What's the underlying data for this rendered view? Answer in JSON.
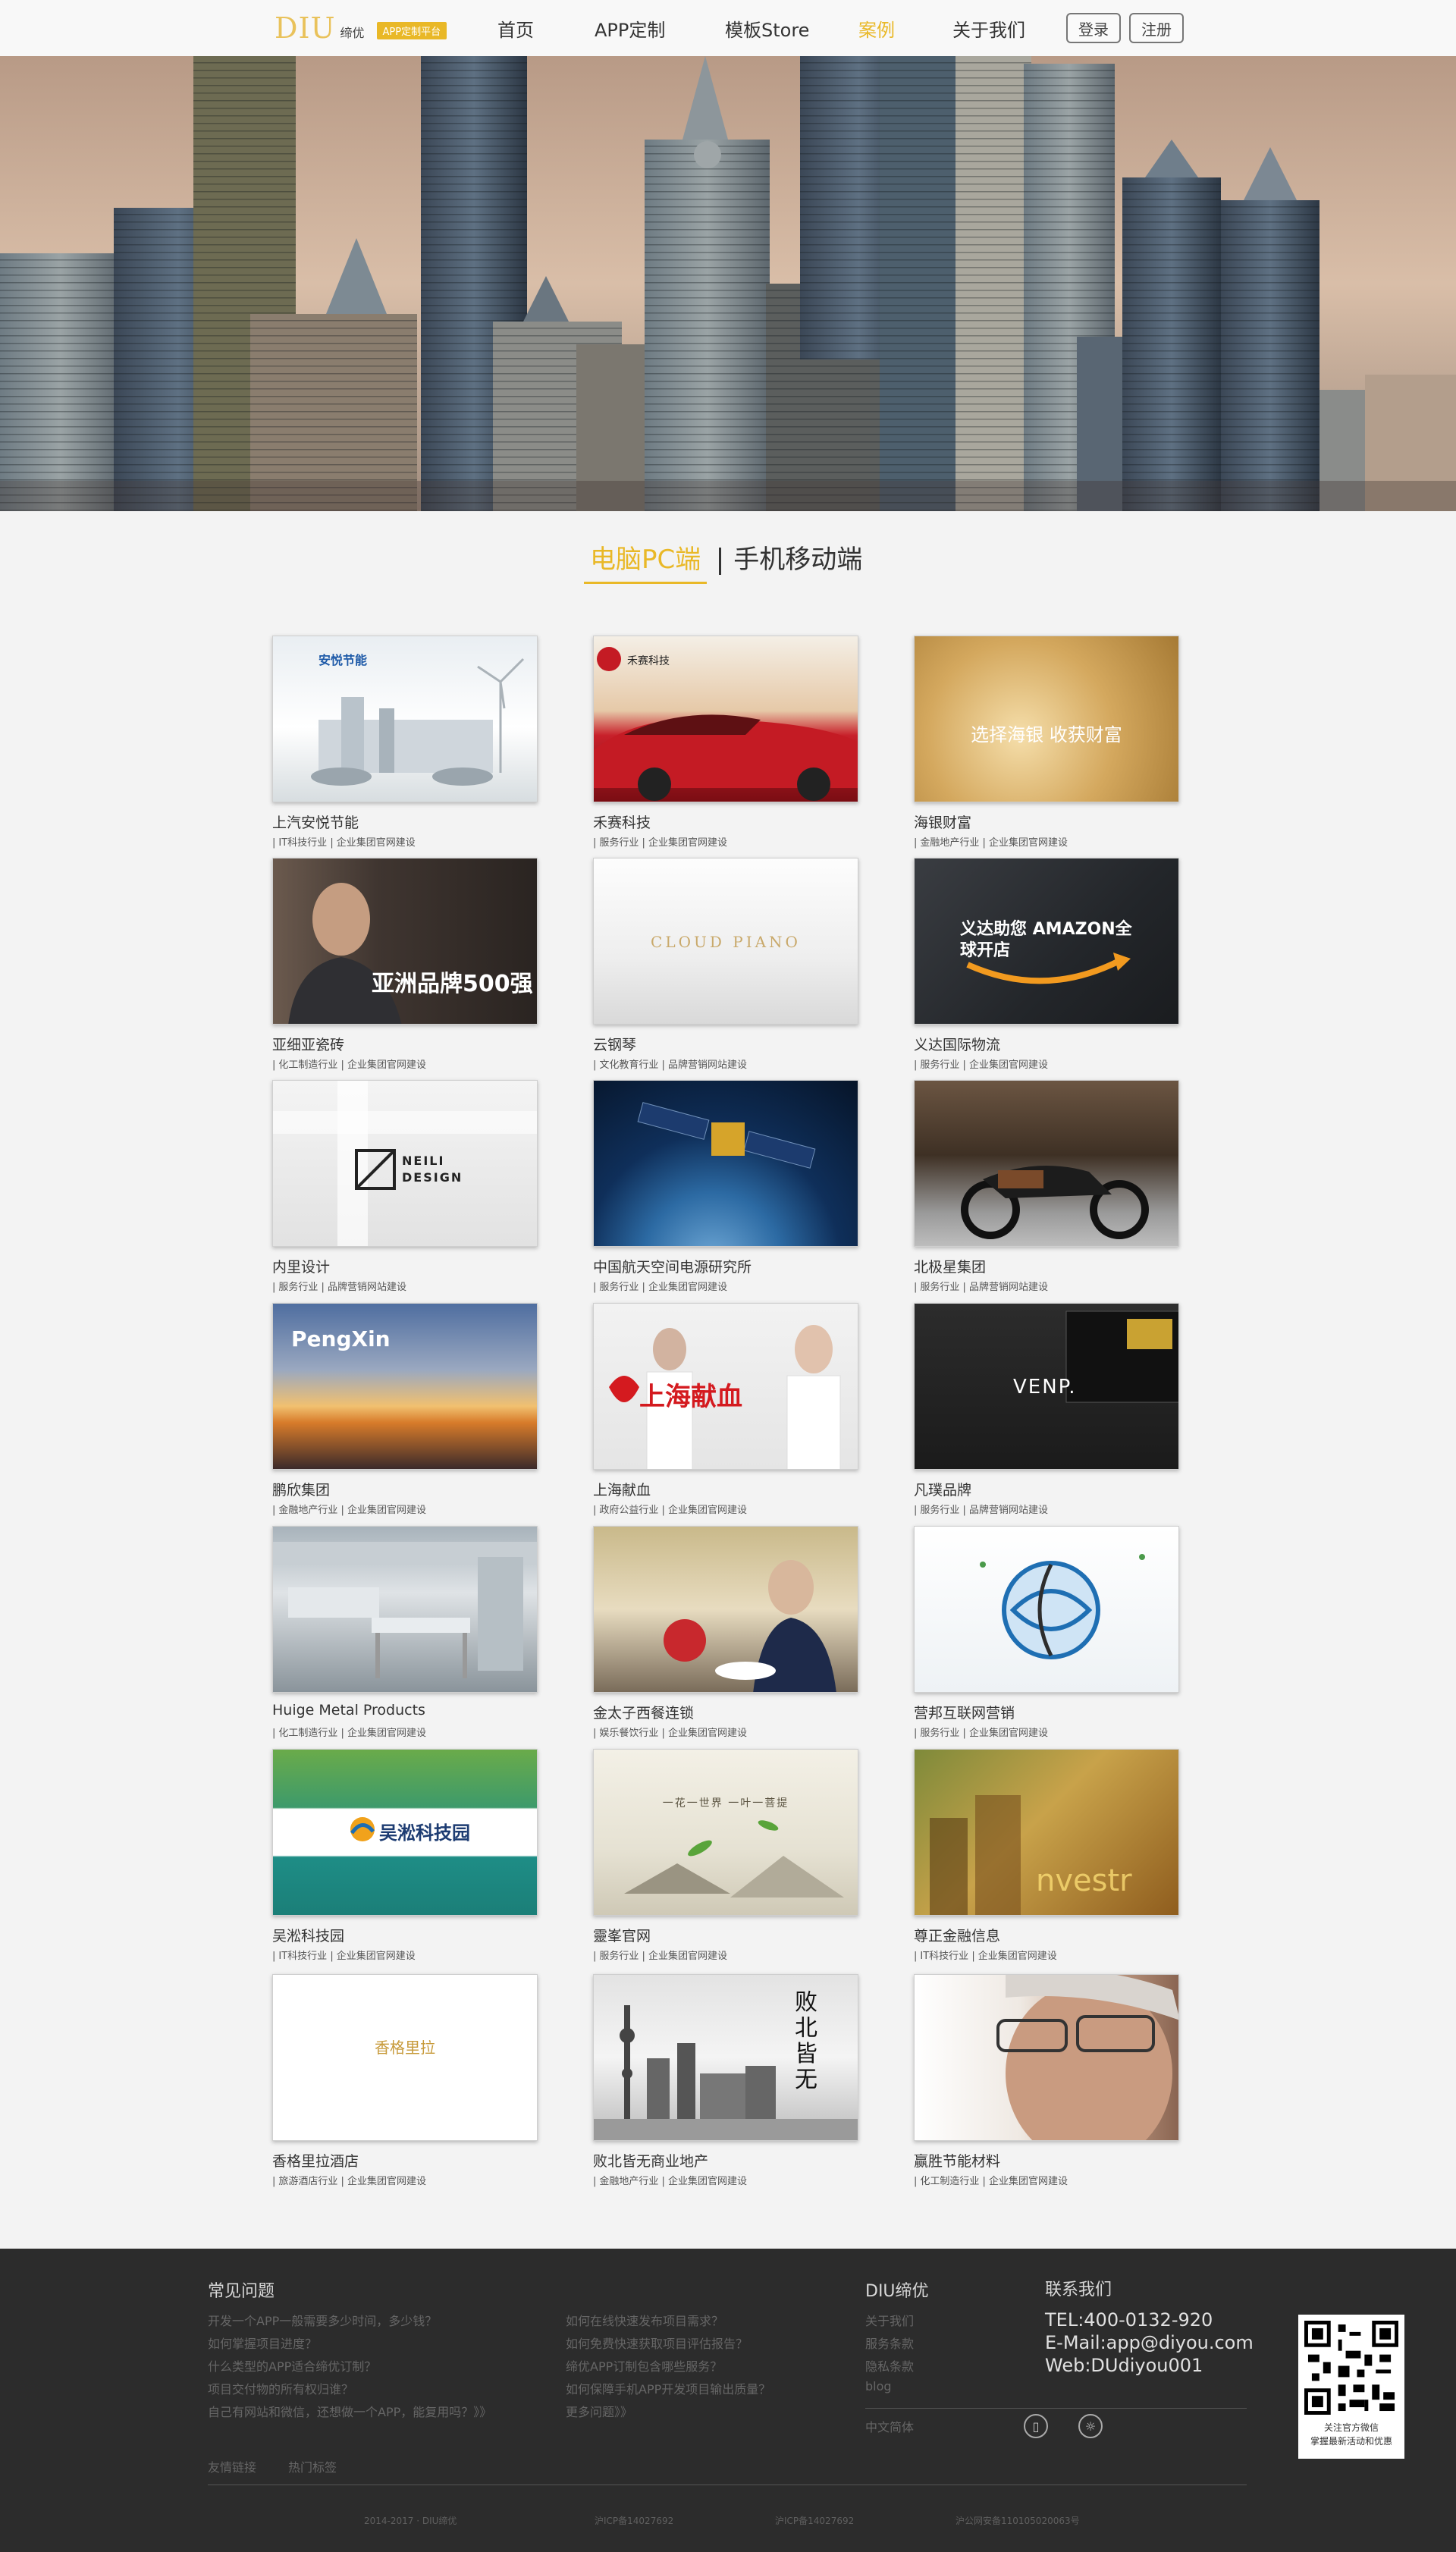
{
  "header": {
    "logo_mark": "DIU",
    "logo_name": "缔优",
    "logo_badge": "APP定制平台",
    "nav": [
      "首页",
      "APP定制",
      "模板Store",
      "案例",
      "关于我们"
    ],
    "active_nav": "案例",
    "login": "登录",
    "register": "注册"
  },
  "tabs": {
    "pc": "电脑PC端",
    "mobile": "手机移动端"
  },
  "cases": [
    {
      "title": "上汽安悦节能",
      "tags": [
        "IT科技行业",
        "企业集团官网建设"
      ],
      "thumb_text": "安悦节能"
    },
    {
      "title": "禾赛科技",
      "tags": [
        "服务行业",
        "企业集团官网建设"
      ],
      "thumb_text": "禾赛科技"
    },
    {
      "title": "海银财富",
      "tags": [
        "金融地产行业",
        "企业集团官网建设"
      ],
      "thumb_text": "选择海银 收获财富"
    },
    {
      "title": "亚细亚瓷砖",
      "tags": [
        "化工制造行业",
        "企业集团官网建设"
      ],
      "thumb_text": "亚洲品牌500强"
    },
    {
      "title": "云钢琴",
      "tags": [
        "文化教育行业",
        "品牌营销网站建设"
      ],
      "thumb_text": "CLOUD PIANO"
    },
    {
      "title": "义达国际物流",
      "tags": [
        "服务行业",
        "企业集团官网建设"
      ],
      "thumb_text": "义达助您 AMAZON全球开店"
    },
    {
      "title": "内里设计",
      "tags": [
        "服务行业",
        "品牌营销网站建设"
      ],
      "thumb_text": "NEILI DESIGN"
    },
    {
      "title": "中国航天空间电源研究所",
      "tags": [
        "服务行业",
        "企业集团官网建设"
      ],
      "thumb_text": ""
    },
    {
      "title": "北极星集团",
      "tags": [
        "服务行业",
        "品牌营销网站建设"
      ],
      "thumb_text": ""
    },
    {
      "title": "鹏欣集团",
      "tags": [
        "金融地产行业",
        "企业集团官网建设"
      ],
      "thumb_text": "PengXin"
    },
    {
      "title": "上海献血",
      "tags": [
        "政府公益行业",
        "企业集团官网建设"
      ],
      "thumb_text": "上海献血"
    },
    {
      "title": "凡璞品牌",
      "tags": [
        "服务行业",
        "品牌营销网站建设"
      ],
      "thumb_text": "VENP."
    },
    {
      "title": "Huige Metal Products",
      "tags": [
        "化工制造行业",
        "企业集团官网建设"
      ],
      "thumb_text": ""
    },
    {
      "title": "金太子西餐连锁",
      "tags": [
        "娱乐餐饮行业",
        "企业集团官网建设"
      ],
      "thumb_text": ""
    },
    {
      "title": "营邦互联网营销",
      "tags": [
        "服务行业",
        "企业集团官网建设"
      ],
      "thumb_text": ""
    },
    {
      "title": "吴淞科技园",
      "tags": [
        "IT科技行业",
        "企业集团官网建设"
      ],
      "thumb_text": "吴淞科技园"
    },
    {
      "title": "靈峯官网",
      "tags": [
        "服务行业",
        "企业集团官网建设"
      ],
      "thumb_text": "一花一世界 一叶一菩提"
    },
    {
      "title": "尊正金融信息",
      "tags": [
        "IT科技行业",
        "企业集团官网建设"
      ],
      "thumb_text": "nvestr"
    },
    {
      "title": "香格里拉酒店",
      "tags": [
        "旅游酒店行业",
        "企业集团官网建设"
      ],
      "thumb_text": "香格里拉"
    },
    {
      "title": "败北皆无商业地产",
      "tags": [
        "金融地产行业",
        "企业集团官网建设"
      ],
      "thumb_text": "败北皆无"
    },
    {
      "title": "赢胜节能材料",
      "tags": [
        "化工制造行业",
        "企业集团官网建设"
      ],
      "thumb_text": ""
    }
  ],
  "footer": {
    "faq_title": "常见问题",
    "faq_col1": [
      "开发一个APP一般需要多少时间，多少钱？",
      "如何掌握项目进度？",
      "什么类型的APP适合缔优订制？",
      "项目交付物的所有权归谁？",
      "自己有网站和微信，还想做一个APP，能复用吗？》》"
    ],
    "faq_col2": [
      "如何在线快速发布项目需求？",
      "如何免费快速获取项目评估报告？",
      "缔优APP订制包含哪些服务？",
      "如何保障手机APP开发项目输出质量？",
      "更多问题》》"
    ],
    "diu_title": "DIU缔优",
    "diu_links": [
      "关于我们",
      "服务条款",
      "隐私条款",
      "blog"
    ],
    "lang": "中文简体",
    "contact_title": "联系我们",
    "tel": "TEL:400-0132-920",
    "email": "E-Mail:app@diyou.com",
    "web": "Web:DUdiyou001",
    "qr_line1": "关注官方微信",
    "qr_line2": "掌握最新活动和优惠",
    "links": [
      "友情链接",
      "热门标签"
    ],
    "copyright": "2014-2017 · DIU缔优",
    "icp1": "沪ICP备14027692",
    "icp2": "沪ICP备14027692",
    "police": "沪公网安备110105020063号"
  }
}
